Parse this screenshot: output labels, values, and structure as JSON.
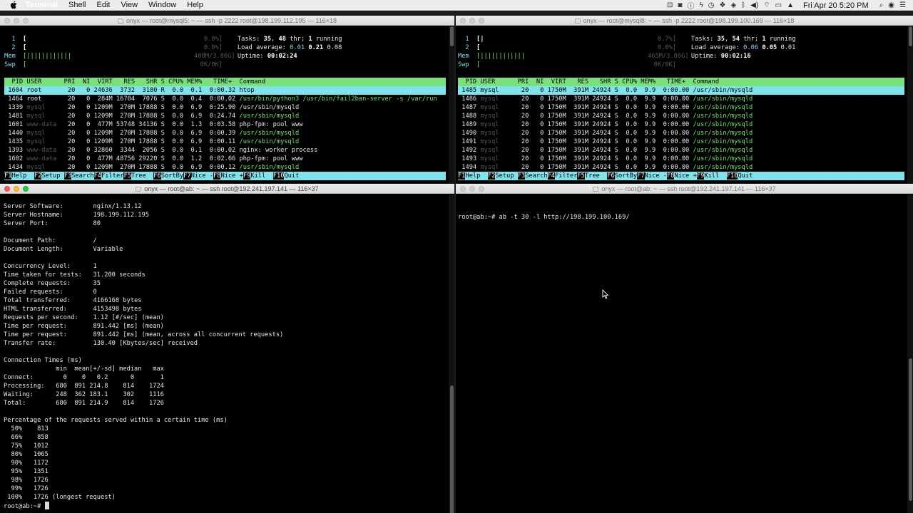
{
  "menubar": {
    "app": "Terminal",
    "items": [
      "Shell",
      "Edit",
      "View",
      "Window",
      "Help"
    ],
    "clock": "Fri Apr 20  5:20 PM"
  },
  "win1": {
    "title": "onyx — root@mysql5: ~ — ssh -p 2222 root@198.199.112.195 — 116×18",
    "meters": [
      {
        "label": "1",
        "bar": "[",
        "val": "0.0%]"
      },
      {
        "label": "2",
        "bar": "[",
        "val": "0.0%]"
      },
      {
        "label": "Mem",
        "bar": "[||||||||||||",
        "val": "408M/3.86G]"
      },
      {
        "label": "Swp",
        "bar": "[",
        "val": "0K/0K]"
      }
    ],
    "tasks_label": "Tasks:",
    "tasks_a": "35",
    "tasks_b": "48",
    "tasks_thr": "thr;",
    "tasks_run": "1",
    "tasks_running": "running",
    "load_label": "Load average:",
    "load1": "0.01",
    "load5": "0.21",
    "load15": "0.08",
    "uptime_label": "Uptime:",
    "uptime": "00:02:24",
    "header": "  PID USER      PRI  NI  VIRT   RES   SHR S CPU% MEM%   TIME+  Command",
    "rows": [
      {
        "pid": " 1604",
        "user": "root    ",
        "rest": "   20   0 24636  3732  3180 R  0.0  0.1  0:00.32 ",
        "cmd": "htop",
        "sel": true,
        "cg": false,
        "ud": false
      },
      {
        "pid": " 1464",
        "user": "root    ",
        "rest": "   20   0  284M 16704  7076 S  0.0  0.4  0:00.02 ",
        "cmd": "/usr/bin/python3 /usr/bin/fail2ban-server -s /var/run",
        "sel": false,
        "cg": true,
        "ud": false
      },
      {
        "pid": " 1339",
        "user": "mysql   ",
        "rest": "   20   0 1209M  270M 17888 S  0.0  6.9  0:25.90 ",
        "cmd": "/usr/sbin/mysqld",
        "sel": false,
        "cg": false,
        "ud": true
      },
      {
        "pid": " 1481",
        "user": "mysql   ",
        "rest": "   20   0 1209M  270M 17888 S  0.0  6.9  0:24.74 ",
        "cmd": "/usr/sbin/mysqld",
        "sel": false,
        "cg": true,
        "ud": true
      },
      {
        "pid": " 1601",
        "user": "www-data",
        "rest": "   20   0  477M 53748 34136 S  0.0  1.3  0:03.58 ",
        "cmd": "php-fpm: pool www",
        "sel": false,
        "cg": false,
        "ud": true
      },
      {
        "pid": " 1440",
        "user": "mysql   ",
        "rest": "   20   0 1209M  270M 17888 S  0.0  6.9  0:00.39 ",
        "cmd": "/usr/sbin/mysqld",
        "sel": false,
        "cg": true,
        "ud": true
      },
      {
        "pid": " 1435",
        "user": "mysql   ",
        "rest": "   20   0 1209M  270M 17888 S  0.0  6.9  0:00.11 ",
        "cmd": "/usr/sbin/mysqld",
        "sel": false,
        "cg": true,
        "ud": true
      },
      {
        "pid": " 1393",
        "user": "www-data",
        "rest": "   20   0 32860  3344  2056 S  0.0  0.1  0:00.02 ",
        "cmd": "nginx: worker process",
        "sel": false,
        "cg": false,
        "ud": true
      },
      {
        "pid": " 1602",
        "user": "www-data",
        "rest": "   20   0  477M 48756 29220 S  0.0  1.2  0:02.66 ",
        "cmd": "php-fpm: pool www",
        "sel": false,
        "cg": false,
        "ud": true
      },
      {
        "pid": " 1434",
        "user": "mysql   ",
        "rest": "   20   0 1209M  270M 17888 S  0.0  6.9  0:00.12 ",
        "cmd": "/usr/sbin/mysqld",
        "sel": false,
        "cg": true,
        "ud": true
      }
    ]
  },
  "win2": {
    "title": "onyx — root@mysql8: ~ — ssh -p 2222 root@198.199.100.169 — 116×18",
    "meters": [
      {
        "label": "1",
        "bar": "[|",
        "val": "0.7%]"
      },
      {
        "label": "2",
        "bar": "[",
        "val": "0.0%]"
      },
      {
        "label": "Mem",
        "bar": "[||||||||||||",
        "val": "465M/3.86G]"
      },
      {
        "label": "Swp",
        "bar": "[",
        "val": "0K/0K]"
      }
    ],
    "tasks_label": "Tasks:",
    "tasks_a": "35",
    "tasks_b": "54",
    "tasks_thr": "thr;",
    "tasks_run": "1",
    "tasks_running": "running",
    "load_label": "Load average:",
    "load1": "0.06",
    "load5": "0.05",
    "load15": "0.01",
    "uptime_label": "Uptime:",
    "uptime": "00:02:16",
    "header": "  PID USER      PRI  NI  VIRT   RES   SHR S CPU% MEM%   TIME+  Command",
    "rows": [
      {
        "pid": " 1485",
        "user": "mysql   ",
        "rest": "   20   0 1750M  391M 24924 S  0.0  9.9  0:00.00 ",
        "cmd": "/usr/sbin/mysqld",
        "sel": true,
        "cg": false,
        "ud": false
      },
      {
        "pid": " 1486",
        "user": "mysql   ",
        "rest": "   20   0 1750M  391M 24924 S  0.0  9.9  0:00.00 ",
        "cmd": "/usr/sbin/mysqld",
        "sel": false,
        "cg": true,
        "ud": true
      },
      {
        "pid": " 1487",
        "user": "mysql   ",
        "rest": "   20   0 1750M  391M 24924 S  0.0  9.9  0:00.00 ",
        "cmd": "/usr/sbin/mysqld",
        "sel": false,
        "cg": true,
        "ud": true
      },
      {
        "pid": " 1488",
        "user": "mysql   ",
        "rest": "   20   0 1750M  391M 24924 S  0.0  9.9  0:00.00 ",
        "cmd": "/usr/sbin/mysqld",
        "sel": false,
        "cg": true,
        "ud": true
      },
      {
        "pid": " 1489",
        "user": "mysql   ",
        "rest": "   20   0 1750M  391M 24924 S  0.0  9.9  0:00.00 ",
        "cmd": "/usr/sbin/mysqld",
        "sel": false,
        "cg": true,
        "ud": true
      },
      {
        "pid": " 1490",
        "user": "mysql   ",
        "rest": "   20   0 1750M  391M 24924 S  0.0  9.9  0:00.00 ",
        "cmd": "/usr/sbin/mysqld",
        "sel": false,
        "cg": true,
        "ud": true
      },
      {
        "pid": " 1491",
        "user": "mysql   ",
        "rest": "   20   0 1750M  391M 24924 S  0.0  9.9  0:00.00 ",
        "cmd": "/usr/sbin/mysqld",
        "sel": false,
        "cg": true,
        "ud": true
      },
      {
        "pid": " 1492",
        "user": "mysql   ",
        "rest": "   20   0 1750M  391M 24924 S  0.0  9.9  0:00.00 ",
        "cmd": "/usr/sbin/mysqld",
        "sel": false,
        "cg": true,
        "ud": true
      },
      {
        "pid": " 1493",
        "user": "mysql   ",
        "rest": "   20   0 1750M  391M 24924 S  0.0  9.9  0:00.00 ",
        "cmd": "/usr/sbin/mysqld",
        "sel": false,
        "cg": true,
        "ud": true
      },
      {
        "pid": " 1494",
        "user": "mysql   ",
        "rest": "   20   0 1750M  391M 24924 S  0.0  9.9  0:00.00 ",
        "cmd": "/usr/sbin/mysqld",
        "sel": false,
        "cg": true,
        "ud": true
      }
    ]
  },
  "fkeys": [
    {
      "key": "F1",
      "label": "Help  "
    },
    {
      "key": "F2",
      "label": "Setup "
    },
    {
      "key": "F3",
      "label": "Search"
    },
    {
      "key": "F4",
      "label": "Filter"
    },
    {
      "key": "F5",
      "label": "Tree  "
    },
    {
      "key": "F6",
      "label": "SortBy"
    },
    {
      "key": "F7",
      "label": "Nice -"
    },
    {
      "key": "F8",
      "label": "Nice +"
    },
    {
      "key": "F9",
      "label": "Kill  "
    },
    {
      "key": "F10",
      "label": "Quit"
    }
  ],
  "win3": {
    "title": "onyx — root@ab: ~ — ssh root@192.241.197.141 — 116×37",
    "lines": [
      "Server Software:        nginx/1.13.12",
      "Server Hostname:        198.199.112.195",
      "Server Port:            80",
      "",
      "Document Path:          /",
      "Document Length:        Variable",
      "",
      "Concurrency Level:      1",
      "Time taken for tests:   31.200 seconds",
      "Complete requests:      35",
      "Failed requests:        0",
      "Total transferred:      4166168 bytes",
      "HTML transferred:       4153498 bytes",
      "Requests per second:    1.12 [#/sec] (mean)",
      "Time per request:       891.442 [ms] (mean)",
      "Time per request:       891.442 [ms] (mean, across all concurrent requests)",
      "Transfer rate:          130.40 [Kbytes/sec] received",
      "",
      "Connection Times (ms)",
      "              min  mean[+/-sd] median   max",
      "Connect:        0    0   0.2      0       1",
      "Processing:   680  891 214.8    814    1724",
      "Waiting:      248  362 183.1    302    1116",
      "Total:        680  891 214.9    814    1726",
      "",
      "Percentage of the requests served within a certain time (ms)",
      "  50%    813",
      "  66%    858",
      "  75%   1012",
      "  80%   1065",
      "  90%   1172",
      "  95%   1351",
      "  98%   1726",
      "  99%   1726",
      " 100%   1726 (longest request)"
    ],
    "prompt": "root@ab:~# "
  },
  "win4": {
    "title": "onyx — root@ab: ~ — ssh root@192.241.197.141 — 116×37",
    "command": "root@ab:~# ab -t 30 -l http://198.199.100.169/"
  }
}
